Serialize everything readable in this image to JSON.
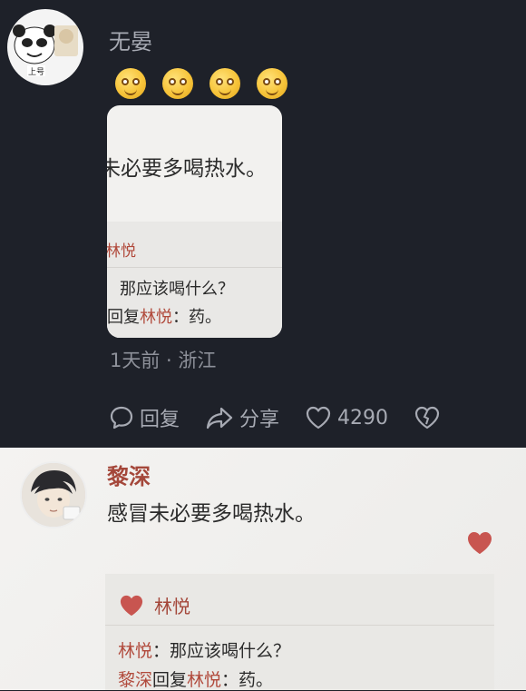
{
  "comment": {
    "username": "无晏",
    "emoji_count": 4,
    "timestamp": "1天前",
    "separator": " · ",
    "location": "浙江"
  },
  "thumbnail": {
    "comment_text": "未必要多喝热水。",
    "reply_name": "林悦",
    "reply_q1": "那应该喝什么？",
    "reply_q2_prefix": "回复",
    "reply_q2_name": "林悦",
    "reply_q2_suffix": "：药。"
  },
  "actions": {
    "reply_label": "回复",
    "share_label": "分享",
    "like_count": "4290"
  },
  "post": {
    "author": "黎深",
    "text": "感冒未必要多喝热水。",
    "reply_box": {
      "liker": "林悦",
      "line1_name": "林悦",
      "line1_text": "：那应该喝什么？",
      "line2_name": "黎深",
      "line2_mid": "回复",
      "line2_target": "林悦",
      "line2_text": "：药。"
    }
  },
  "colors": {
    "dark_bg": "#1e2129",
    "accent_red": "#b14a3c",
    "heart_red": "#c85550"
  }
}
